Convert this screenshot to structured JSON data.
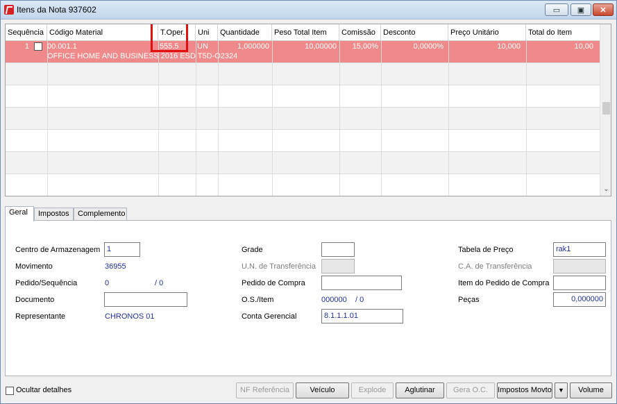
{
  "window": {
    "title": "Itens da Nota 937602",
    "buttons": {
      "minimize": "▭",
      "restore": "▣",
      "close": "✕"
    }
  },
  "grid": {
    "columns": [
      "Sequência",
      "Código Material",
      "T.Oper.",
      "Uni",
      "Quantidade",
      "Peso Total Item",
      "Comissão",
      "Desconto",
      "Preço Unitário",
      "Total do Item"
    ],
    "rows": [
      {
        "seq": "1",
        "codigo": "00.001.1",
        "toper": "555.5",
        "uni": "UN",
        "quantidade": "1,000000",
        "peso": "10,00000",
        "comissao": "15,00%",
        "desconto": "0,0000%",
        "preco": "10,000",
        "total": "10,00",
        "descricao": "OFFICE HOME AND BUSINESS 2016 ESD T5D-O2324"
      }
    ]
  },
  "tabs": [
    "Geral",
    "Impostos",
    "Complemento"
  ],
  "form": {
    "centro_armazenagem": {
      "label": "Centro de Armazenagem",
      "value": "1"
    },
    "movimento": {
      "label": "Movimento",
      "value": "36955"
    },
    "pedido_sequencia": {
      "label": "Pedido/Sequência",
      "value": "0",
      "sep": "/ 0"
    },
    "documento": {
      "label": "Documento",
      "value": ""
    },
    "representante": {
      "label": "Representante",
      "value": "CHRONOS 01"
    },
    "grade": {
      "label": "Grade",
      "value": ""
    },
    "un_transferencia": {
      "label": "U.N. de Transferência",
      "value": ""
    },
    "pedido_compra": {
      "label": "Pedido de Compra",
      "value": ""
    },
    "os_item": {
      "label": "O.S./Item",
      "value": "000000",
      "sep": "/ 0"
    },
    "conta_gerencial": {
      "label": "Conta Gerencial",
      "value": "8.1.1.1.01"
    },
    "tabela_preco": {
      "label": "Tabela de Preço",
      "value": "rak1"
    },
    "ca_transferencia": {
      "label": "C.A. de Transferência",
      "value": ""
    },
    "item_pedido_compra": {
      "label": "Item do Pedido de Compra",
      "value": ""
    },
    "pecas": {
      "label": "Peças",
      "value": "0,000000"
    }
  },
  "footer": {
    "ocultar_detalhes": "Ocultar detalhes",
    "buttons": {
      "nf_referencia": "NF Referência",
      "veiculo": "Veículo",
      "explode": "Explode",
      "aglutinar": "Aglutinar",
      "gera_oc": "Gera O.C.",
      "impostos_movto": "Impostos Movto",
      "dropdown": "▼",
      "volume": "Volume"
    }
  }
}
